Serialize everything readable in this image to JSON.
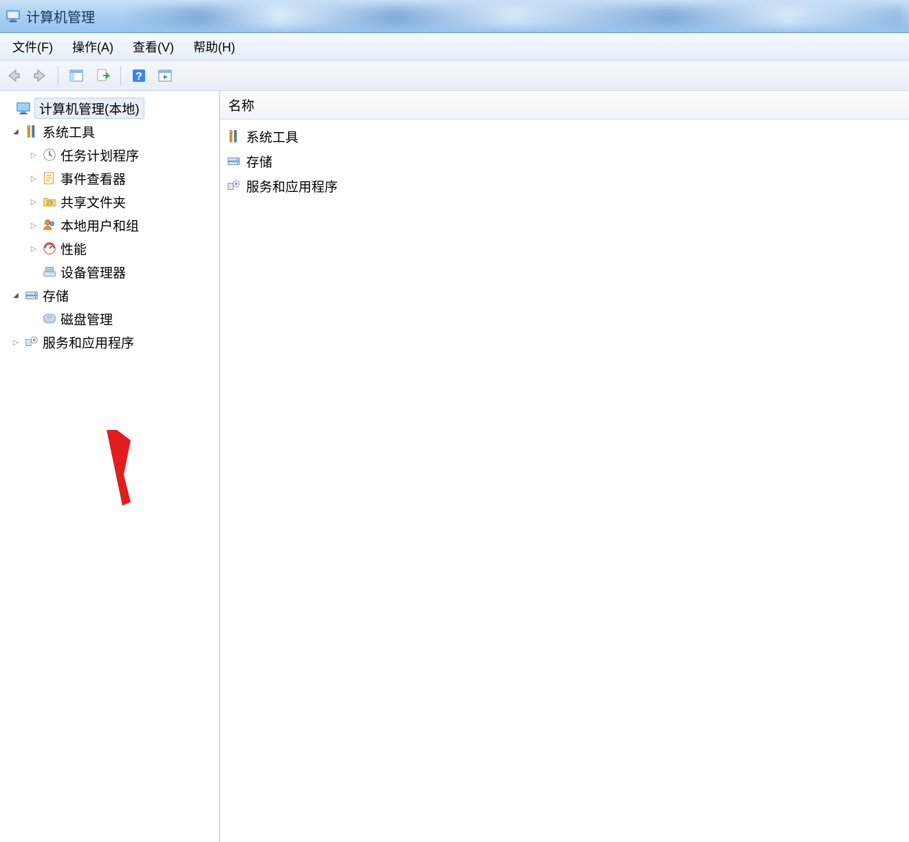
{
  "window": {
    "title": "计算机管理"
  },
  "menu": {
    "file": "文件(F)",
    "action": "操作(A)",
    "view": "查看(V)",
    "help": "帮助(H)"
  },
  "columns": {
    "name": "名称"
  },
  "tree": {
    "root": "计算机管理(本地)",
    "systemTools": "系统工具",
    "taskScheduler": "任务计划程序",
    "eventViewer": "事件查看器",
    "sharedFolders": "共享文件夹",
    "localUsersGroups": "本地用户和组",
    "performance": "性能",
    "deviceManager": "设备管理器",
    "storage": "存储",
    "diskManagement": "磁盘管理",
    "servicesApps": "服务和应用程序"
  },
  "list": {
    "systemTools": "系统工具",
    "storage": "存储",
    "servicesApps": "服务和应用程序"
  }
}
